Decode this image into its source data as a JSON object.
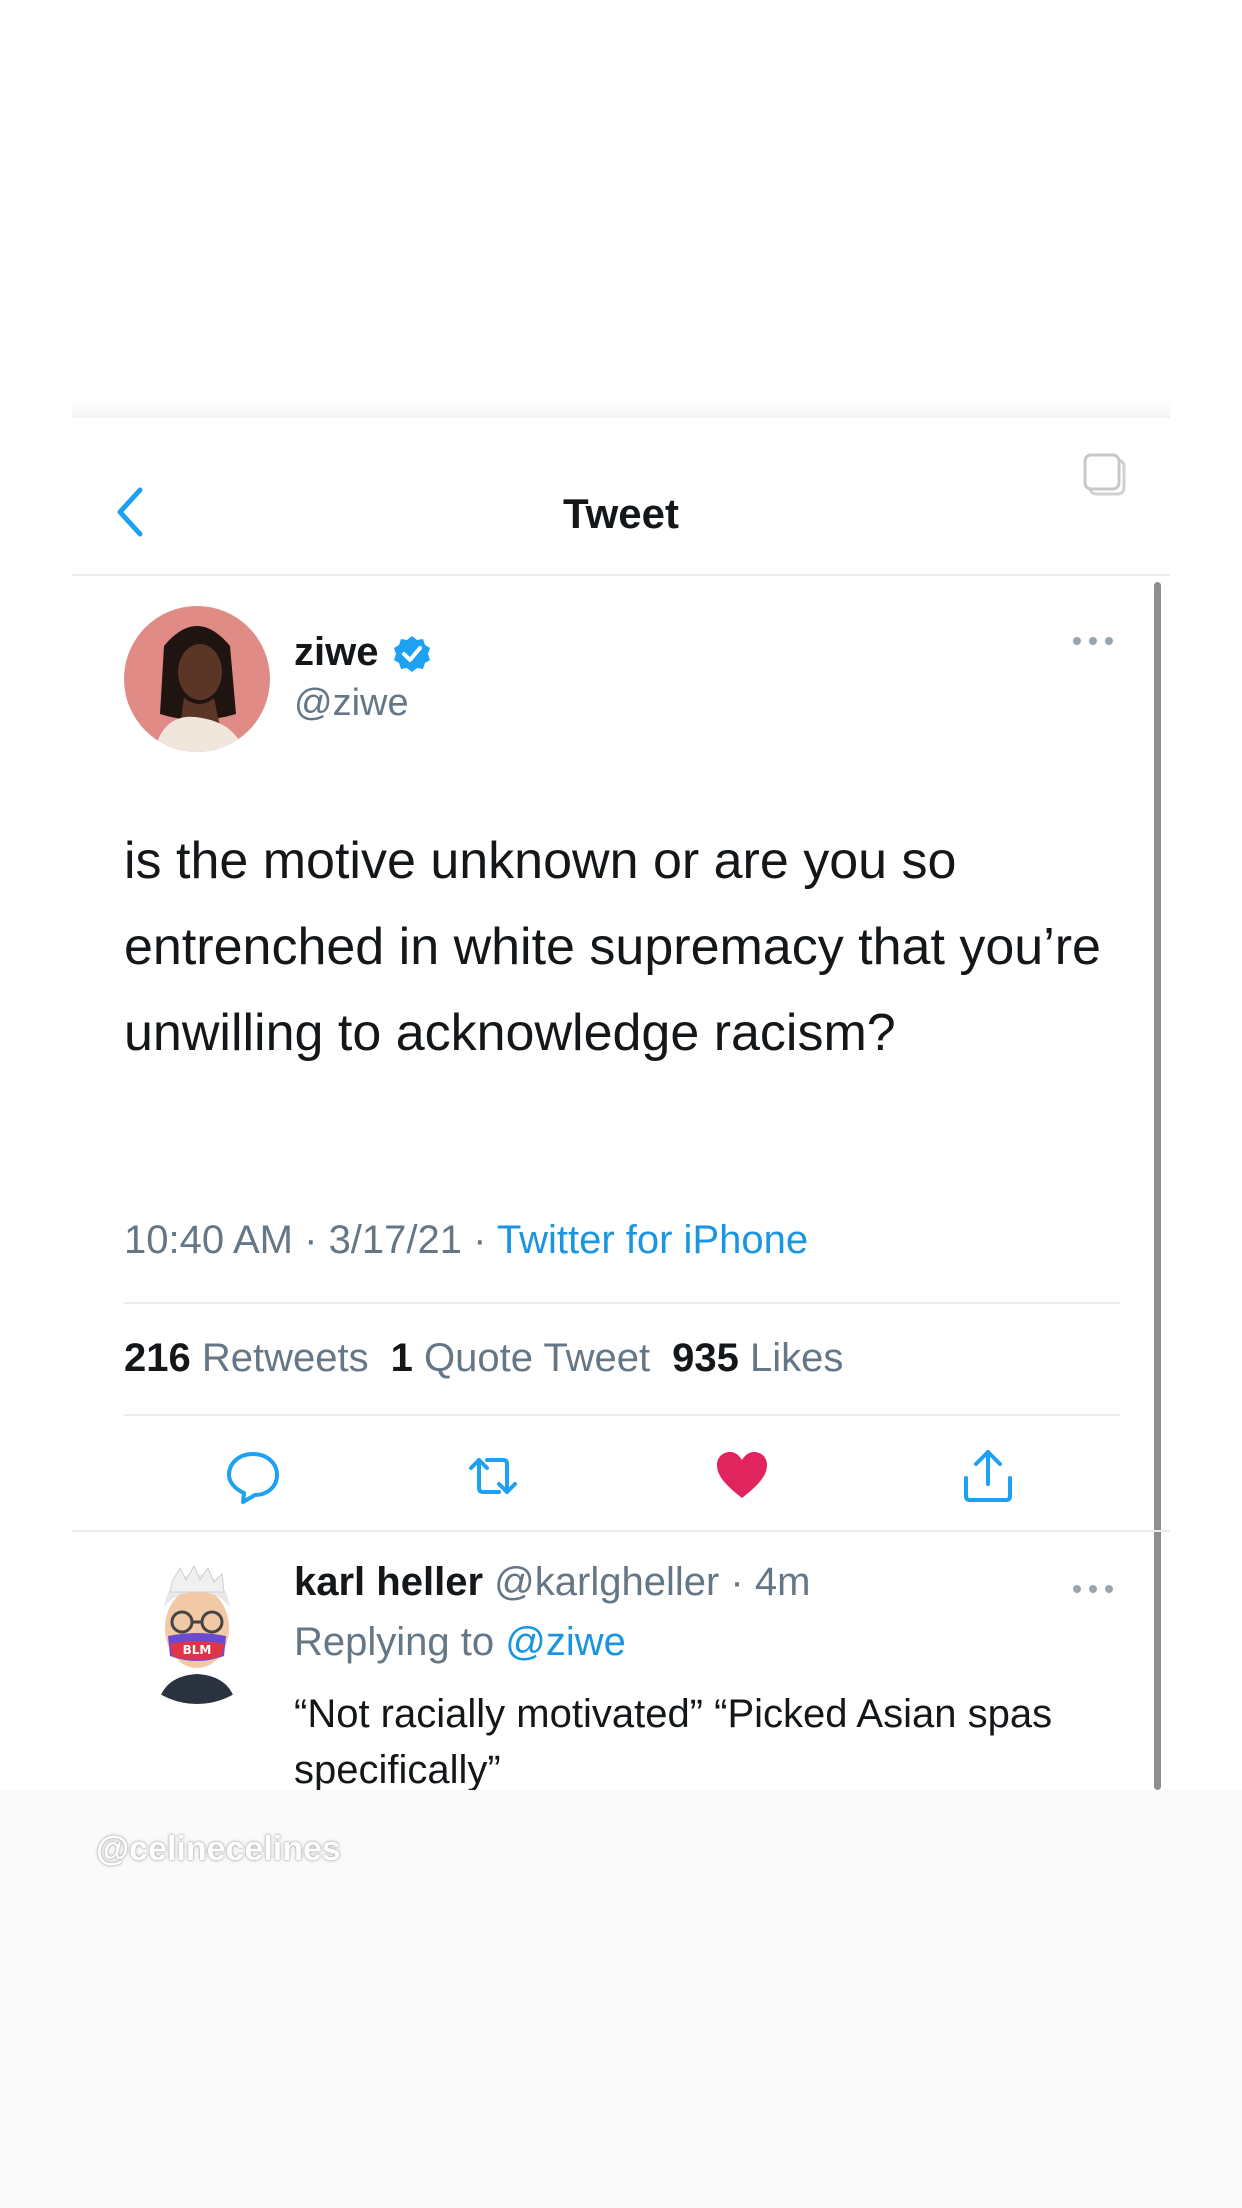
{
  "header": {
    "title": "Tweet"
  },
  "tweet": {
    "author_name": "ziwe",
    "author_handle": "@ziwe",
    "text": "is the motive unknown or are you so entrenched in white supremacy that you’re unwilling to acknowledge racism?",
    "time": "10:40 AM",
    "date": "3/17/21",
    "source": "Twitter for iPhone",
    "separator": " · ",
    "retweets_count": "216",
    "retweets_label": "Retweets",
    "quotes_count": "1",
    "quotes_label": "Quote Tweet",
    "likes_count": "935",
    "likes_label": "Likes",
    "liked": true
  },
  "reply": {
    "author_name": "karl heller",
    "author_handle": "@karlgheller",
    "time": "4m",
    "replying_to_label": "Replying to",
    "replying_to_handle": "@ziwe",
    "text": "“Not racially motivated” “Picked Asian spas specifically”",
    "avatar_badge": "BLM"
  },
  "watermark": "@celinecelines",
  "colors": {
    "accent": "#1da1f2",
    "link": "#1b95e0",
    "like": "#e0245e",
    "muted": "#657786"
  },
  "icons": {
    "back": "chevron-left-icon",
    "copy": "copy-icon",
    "verified": "verified-badge-icon",
    "more": "more-horizontal-icon",
    "reply": "reply-icon",
    "retweet": "retweet-icon",
    "like": "heart-filled-icon",
    "share": "share-icon"
  }
}
